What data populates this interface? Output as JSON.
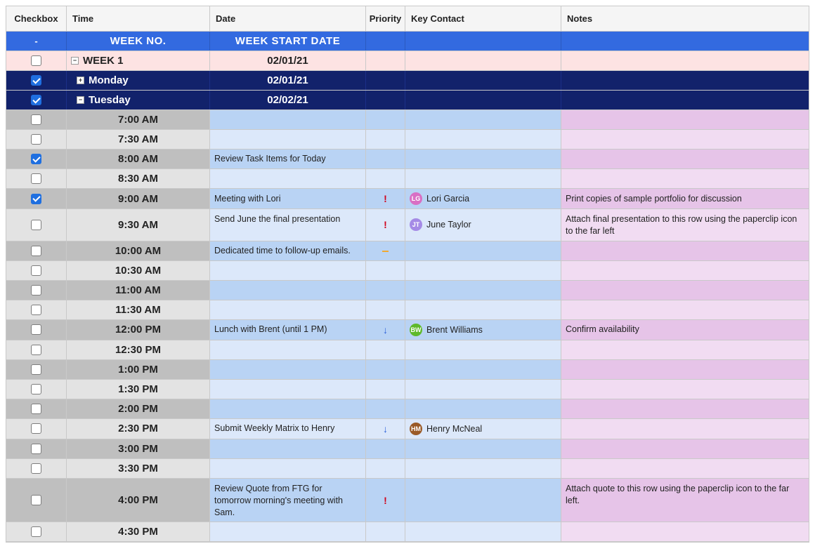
{
  "columns": {
    "checkbox": "Checkbox",
    "time": "Time",
    "date": "Date",
    "priority": "Priority",
    "contact": "Key Contact",
    "notes": "Notes"
  },
  "band": {
    "weekno": "WEEK NO.",
    "weekstart": "WEEK START DATE",
    "dash": "-"
  },
  "week": {
    "label": "WEEK 1",
    "date": "02/01/21",
    "checked": false
  },
  "days": {
    "monday": {
      "label": "Monday",
      "date": "02/01/21",
      "checked": true,
      "expand": "+"
    },
    "tuesday": {
      "label": "Tuesday",
      "date": "02/02/21",
      "checked": true,
      "expand": "−"
    }
  },
  "priority": {
    "high": "!",
    "med": "–",
    "low": "↓"
  },
  "contacts": {
    "lori": {
      "name": "Lori Garcia",
      "initials": "LG",
      "color": "#d96fc4"
    },
    "june": {
      "name": "June Taylor",
      "initials": "JT",
      "color": "#a58ae6"
    },
    "brent": {
      "name": "Brent Williams",
      "initials": "BW",
      "color": "#5eb92b"
    },
    "henry": {
      "name": "Henry McNeal",
      "initials": "HM",
      "color": "#9a5a27"
    }
  },
  "slots": [
    {
      "time": "7:00 AM",
      "checked": false
    },
    {
      "time": "7:30 AM",
      "checked": false
    },
    {
      "time": "8:00 AM",
      "checked": true,
      "task": "Review Task Items for Today"
    },
    {
      "time": "8:30 AM",
      "checked": false
    },
    {
      "time": "9:00 AM",
      "checked": true,
      "task": "Meeting with Lori",
      "priority": "high",
      "contact": "lori",
      "notes": "Print copies of sample portfolio for discussion"
    },
    {
      "time": "9:30 AM",
      "checked": false,
      "task": "Send June the final presentation",
      "priority": "high",
      "contact": "june",
      "notes": "Attach final presentation to this row using the paperclip icon to the far left"
    },
    {
      "time": "10:00 AM",
      "checked": false,
      "task": "Dedicated time to follow-up emails.",
      "priority": "med"
    },
    {
      "time": "10:30 AM",
      "checked": false
    },
    {
      "time": "11:00 AM",
      "checked": false
    },
    {
      "time": "11:30 AM",
      "checked": false
    },
    {
      "time": "12:00 PM",
      "checked": false,
      "task": "Lunch with Brent (until 1 PM)",
      "priority": "low",
      "contact": "brent",
      "notes": "Confirm availability"
    },
    {
      "time": "12:30 PM",
      "checked": false
    },
    {
      "time": "1:00 PM",
      "checked": false
    },
    {
      "time": "1:30 PM",
      "checked": false
    },
    {
      "time": "2:00 PM",
      "checked": false
    },
    {
      "time": "2:30 PM",
      "checked": false,
      "task": "Submit Weekly Matrix to Henry",
      "priority": "low",
      "contact": "henry"
    },
    {
      "time": "3:00 PM",
      "checked": false
    },
    {
      "time": "3:30 PM",
      "checked": false
    },
    {
      "time": "4:00 PM",
      "checked": false,
      "task": "Review Quote from FTG for tomorrow morning's meeting with Sam.",
      "priority": "high",
      "notes": "Attach quote to this row using the paperclip icon to the far left."
    },
    {
      "time": "4:30 PM",
      "checked": false
    }
  ]
}
